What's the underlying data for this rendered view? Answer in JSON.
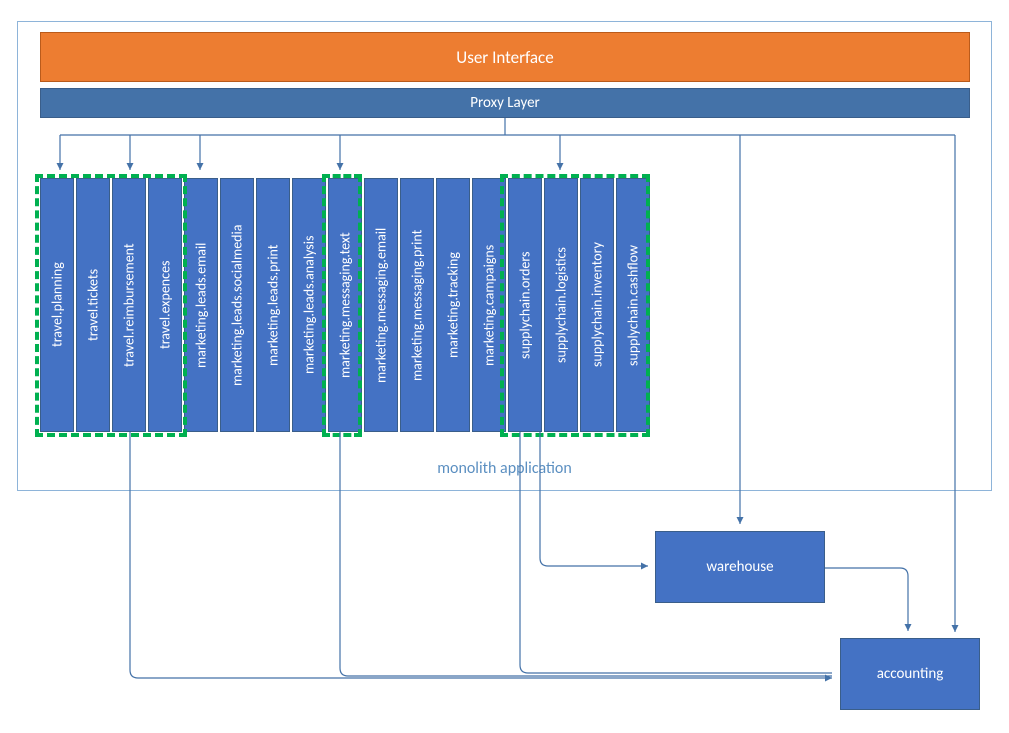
{
  "layers": {
    "ui": "User Interface",
    "proxy": "Proxy Layer",
    "monolith_label": "monolith application"
  },
  "modules": [
    "travel.planning",
    "travel.tickets",
    "travel.reimbursement",
    "travel.expences",
    "marketing.leads.email",
    "marketing.leads.socialmedia",
    "marketing.leads.print",
    "marketing.leads.analysis",
    "marketing.messaging.text",
    "marketing.messaging.email",
    "marketing.messaging.print",
    "marketing.tracking",
    "marketing.campaigns",
    "supplychain.orders",
    "supplychain.logistics",
    "supplychain.inventory",
    "supplychain.cashflow"
  ],
  "external": {
    "warehouse": "warehouse",
    "accounting": "accounting"
  }
}
